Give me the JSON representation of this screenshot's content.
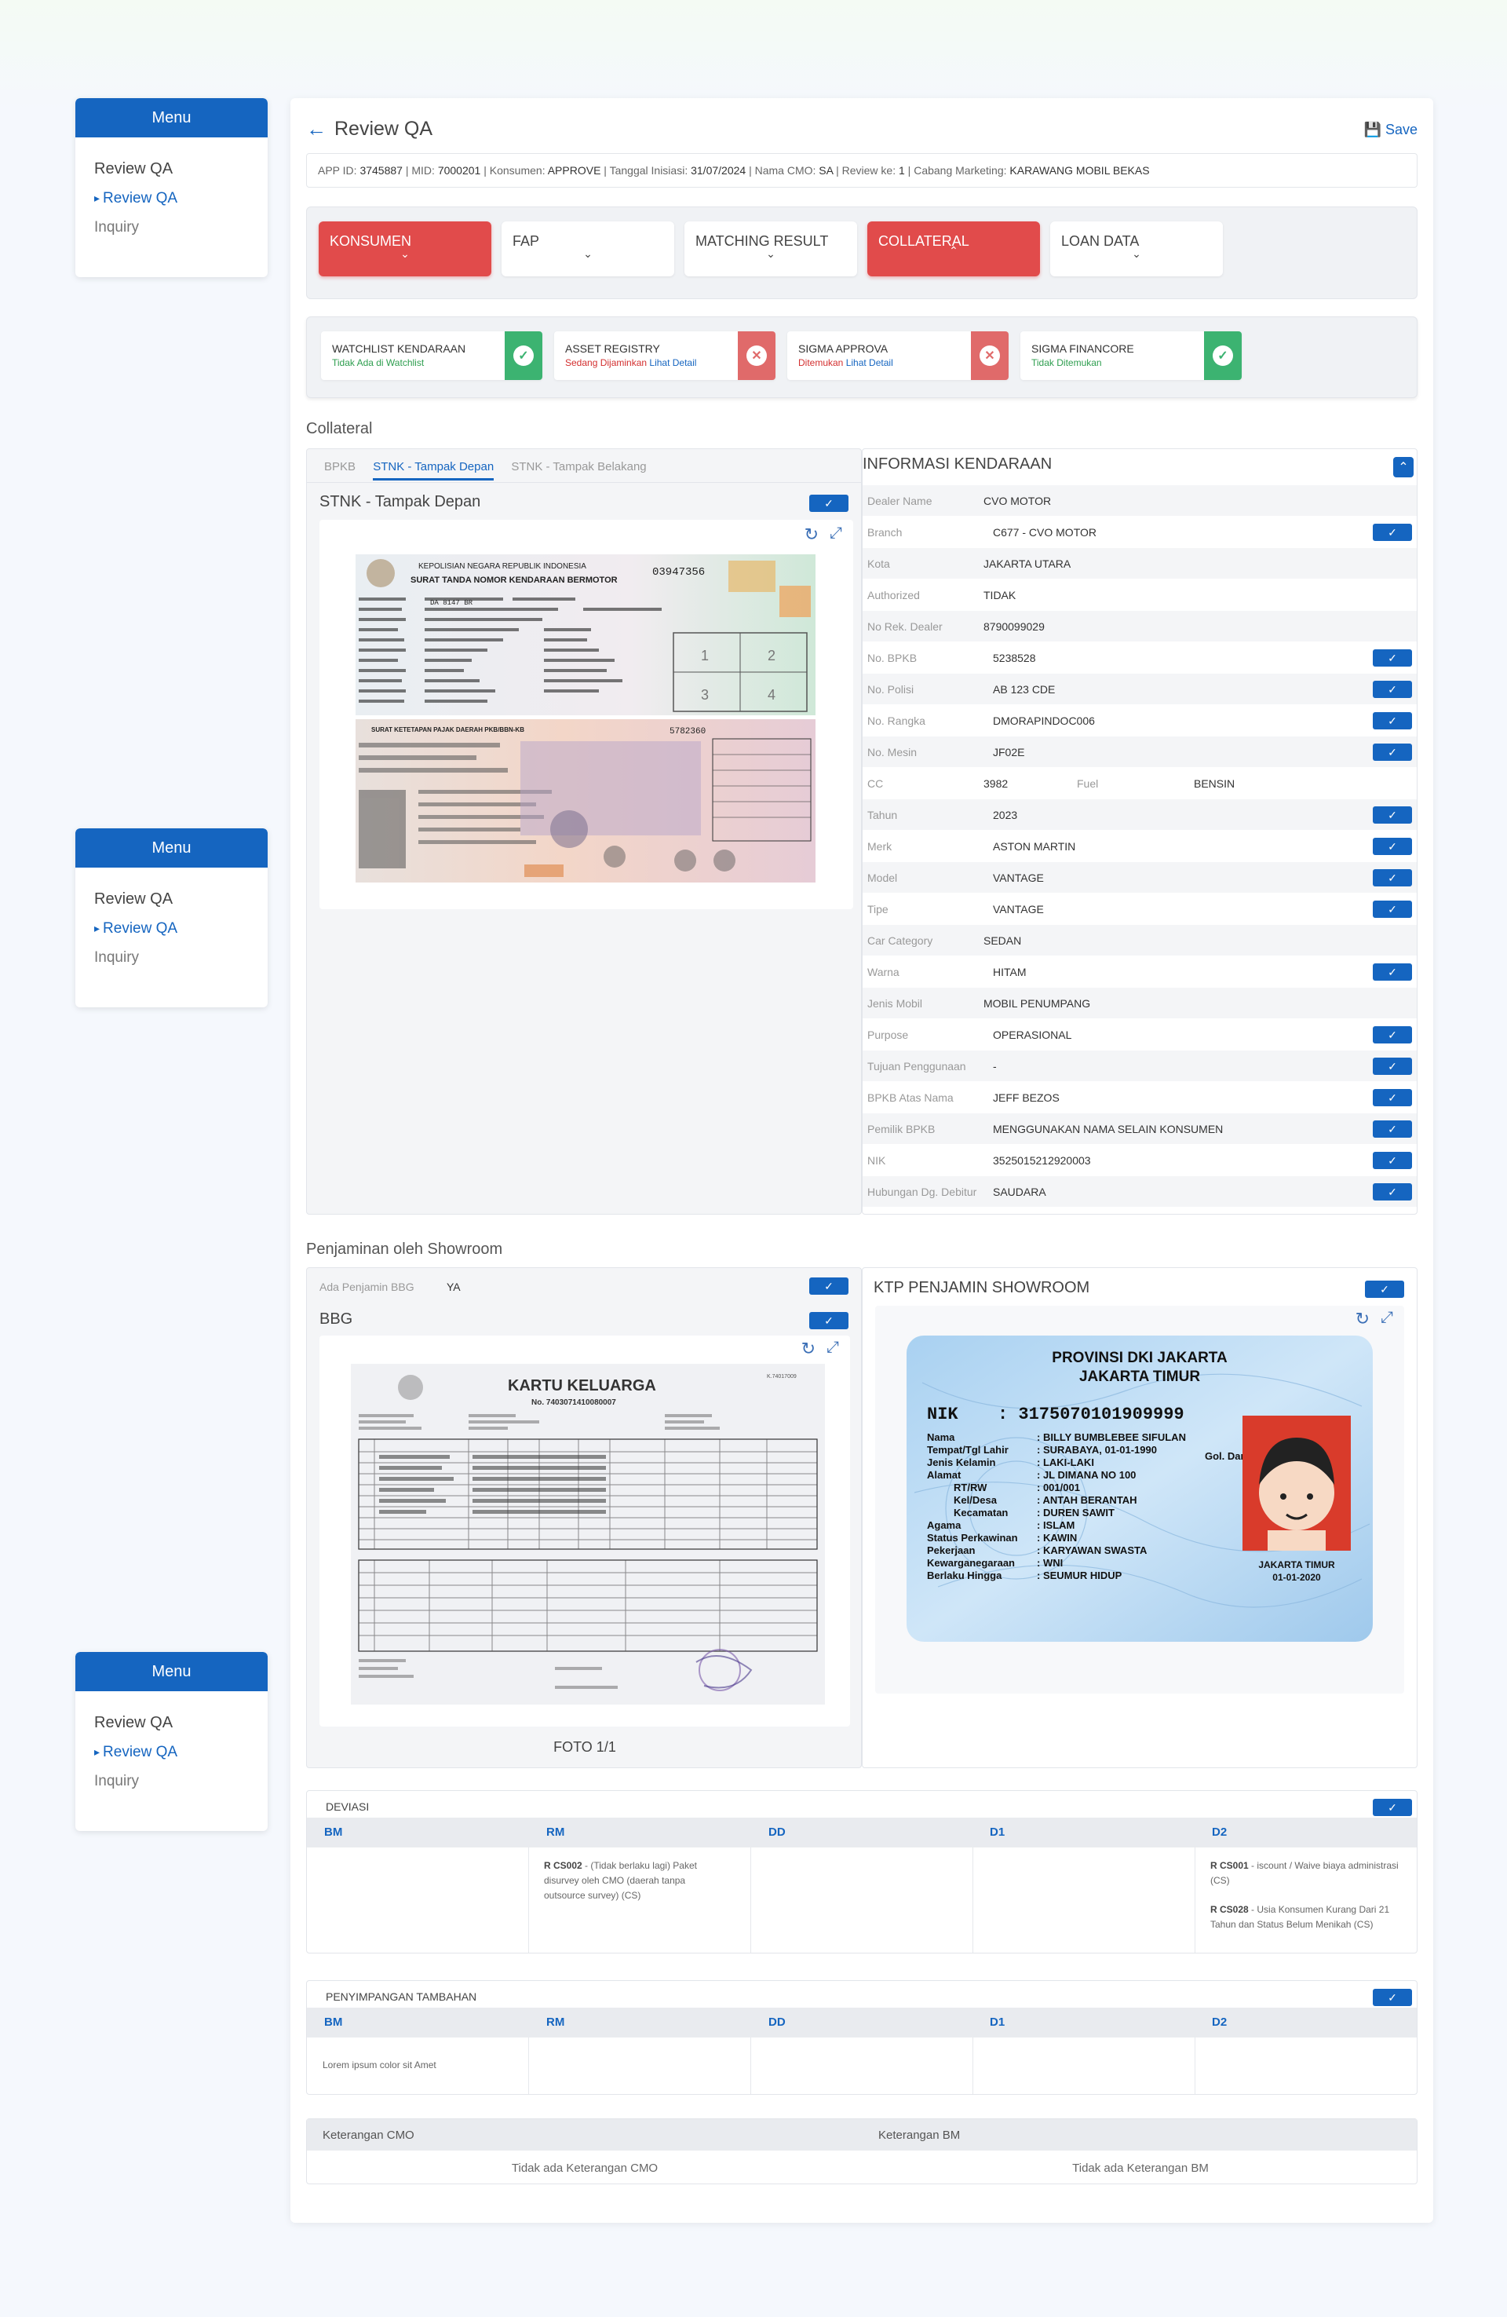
{
  "menus": [
    {
      "header": "Menu",
      "items": [
        "Review QA",
        "Review QA",
        "Inquiry"
      ]
    },
    {
      "header": "Menu",
      "items": [
        "Review QA",
        "Review QA",
        "Inquiry"
      ]
    },
    {
      "header": "Menu",
      "items": [
        "Review QA",
        "Review QA",
        "Inquiry"
      ]
    }
  ],
  "page": {
    "title": "Review QA",
    "save_label": "Save"
  },
  "info": {
    "app_id_label": "APP ID:",
    "app_id": "3745887",
    "mid_label": "MID:",
    "mid": "7000201",
    "konsumen_label": "Konsumen:",
    "konsumen": "APPROVE",
    "tgl_label": "Tanggal Inisiasi:",
    "tgl": "31/07/2024",
    "cmo_label": "Nama CMO:",
    "cmo": "SA",
    "review_label": "Review ke:",
    "review": "1",
    "cabang_label": "Cabang Marketing:",
    "cabang": "KARAWANG MOBIL BEKAS"
  },
  "tabs": [
    {
      "label": "KONSUMEN",
      "status": "red",
      "chevron": "down"
    },
    {
      "label": "FAP",
      "status": "normal",
      "chevron": "down"
    },
    {
      "label": "MATCHING RESULT",
      "status": "normal",
      "chevron": "down"
    },
    {
      "label": "COLLATERAL",
      "status": "red",
      "chevron": "up"
    },
    {
      "label": "LOAN DATA",
      "status": "normal",
      "chevron": "down"
    }
  ],
  "checks": [
    {
      "title": "WATCHLIST KENDARAAN",
      "status": "Tidak Ada di Watchlist",
      "link": "",
      "status_color": "#2e9e4f",
      "badge": "green"
    },
    {
      "title": "ASSET REGISTRY",
      "status": "Sedang Dijaminkan",
      "link": "Lihat Detail",
      "status_color": "#d32f2f",
      "badge": "rose"
    },
    {
      "title": "SIGMA APPROVA",
      "status": "Ditemukan",
      "link": "Lihat Detail",
      "status_color": "#d32f2f",
      "badge": "rose"
    },
    {
      "title": "SIGMA FINANCORE",
      "status": "Tidak Ditemukan",
      "link": "",
      "status_color": "#2e9e4f",
      "badge": "green"
    }
  ],
  "collateral": {
    "section_title": "Collateral",
    "subtabs": [
      "BPKB",
      "STNK - Tampak Depan",
      "STNK - Tampak Belakang"
    ],
    "image_title": "STNK - Tampak Depan",
    "stnk": {
      "header1": "KEPOLISIAN NEGARA REPUBLIK INDONESIA",
      "header2": "SURAT TANDA NOMOR KENDARAAN BERMOTOR",
      "number": "03947356",
      "plate": "DA 8147 BR",
      "footer": "SURAT KETETAPAN PAJAK DAERAH PKB/BBN-KB",
      "serial": "5782360"
    },
    "info_title": "INFORMASI KENDARAAN",
    "fields": [
      {
        "label": "Dealer Name",
        "value": "CVO MOTOR",
        "check": false
      },
      {
        "label": "Branch",
        "value": "C677 - CVO MOTOR",
        "check": true
      },
      {
        "label": "Kota",
        "value": "JAKARTA UTARA",
        "check": false
      },
      {
        "label": "Authorized",
        "value": "TIDAK",
        "check": false
      },
      {
        "label": "No Rek. Dealer",
        "value": "8790099029",
        "check": false
      },
      {
        "label": "No. BPKB",
        "value": "5238528",
        "check": true
      },
      {
        "label": "No. Polisi",
        "value": "AB 123 CDE",
        "check": true
      },
      {
        "label": "No. Rangka",
        "value": "DMORAPINDOC006",
        "check": true
      },
      {
        "label": "No. Mesin",
        "value": "JF02E",
        "check": true
      },
      {
        "label": "CC",
        "value": "3982",
        "extra_label": "Fuel",
        "extra_value": "BENSIN",
        "check": false
      },
      {
        "label": "Tahun",
        "value": "2023",
        "check": true
      },
      {
        "label": "Merk",
        "value": "ASTON MARTIN",
        "check": true
      },
      {
        "label": "Model",
        "value": "VANTAGE",
        "check": true
      },
      {
        "label": "Tipe",
        "value": "VANTAGE",
        "check": true
      },
      {
        "label": "Car Category",
        "value": "SEDAN",
        "check": false
      },
      {
        "label": "Warna",
        "value": "HITAM",
        "check": true
      },
      {
        "label": "Jenis Mobil",
        "value": "MOBIL PENUMPANG",
        "check": false
      },
      {
        "label": "Purpose",
        "value": "OPERASIONAL",
        "check": true
      },
      {
        "label": "Tujuan Penggunaan",
        "value": "-",
        "check": true
      },
      {
        "label": "BPKB Atas Nama",
        "value": "JEFF BEZOS",
        "check": true
      },
      {
        "label": "Pemilik BPKB",
        "value": "MENGGUNAKAN NAMA SELAIN KONSUMEN",
        "check": true
      },
      {
        "label": "NIK",
        "value": "3525015212920003",
        "check": true
      },
      {
        "label": "Hubungan Dg. Debitur",
        "value": "SAUDARA",
        "check": true
      }
    ]
  },
  "showroom": {
    "section_title": "Penjaminan oleh Showroom",
    "bbg_label": "Ada Penjamin BBG",
    "bbg_value": "YA",
    "bbg_title": "BBG",
    "kk": {
      "title": "KARTU KELUARGA",
      "number": "No. 7403071410080007",
      "code": "K.74017009"
    },
    "foto_label": "FOTO 1/1",
    "ktp_title": "KTP PENJAMIN SHOWROOM",
    "ktp": {
      "province": "PROVINSI DKI JAKARTA",
      "city": "JAKARTA TIMUR",
      "nik_label": "NIK",
      "nik": ": 3175070101909999",
      "rows": [
        [
          "Nama",
          ": BILLY BUMBLEBEE SIFULAN"
        ],
        [
          "Tempat/Tgl Lahir",
          ": SURABAYA, 01-01-1990"
        ],
        [
          "Jenis Kelamin",
          ": LAKI-LAKI"
        ],
        [
          "Alamat",
          ": JL DIMANA NO 100"
        ],
        [
          "RT/RW",
          ": 001/001"
        ],
        [
          "Kel/Desa",
          ": ANTAH BERANTAH"
        ],
        [
          "Kecamatan",
          ": DUREN SAWIT"
        ],
        [
          "Agama",
          ": ISLAM"
        ],
        [
          "Status Perkawinan",
          ": KAWIN"
        ],
        [
          "Pekerjaan",
          ": KARYAWAN SWASTA"
        ],
        [
          "Kewarganegaraan",
          ": WNI"
        ],
        [
          "Berlaku Hingga",
          ": SEUMUR HIDUP"
        ]
      ],
      "blood": "Gol. Darah : AB",
      "sign_city": "JAKARTA TIMUR",
      "sign_date": "01-01-2020"
    }
  },
  "deviasi": {
    "title": "DEVIASI",
    "columns": [
      "BM",
      "RM",
      "DD",
      "D1",
      "D2"
    ],
    "rm_code": "R CS002",
    "rm_text": " - (Tidak berlaku lagi) Paket disurvey oleh CMO (daerah tanpa outsource survey) (CS)",
    "d2a_code": "R CS001",
    "d2a_text": " - iscount / Waive biaya administrasi (CS)",
    "d2b_code": "R CS028",
    "d2b_text": " - Usia Konsumen Kurang Dari 21 Tahun dan Status Belum Menikah (CS)"
  },
  "penyimpangan": {
    "title": "PENYIMPANGAN TAMBAHAN",
    "columns": [
      "BM",
      "RM",
      "DD",
      "D1",
      "D2"
    ],
    "bm_text": "Lorem ipsum color sit Amet"
  },
  "keterangan": {
    "cmo_label": "Keterangan CMO",
    "bm_label": "Keterangan BM",
    "cmo_value": "Tidak ada Keterangan CMO",
    "bm_value": "Tidak ada Keterangan BM"
  },
  "colors": {
    "primary": "#1565c0",
    "danger": "#e14b4b",
    "success": "#3cb371"
  }
}
